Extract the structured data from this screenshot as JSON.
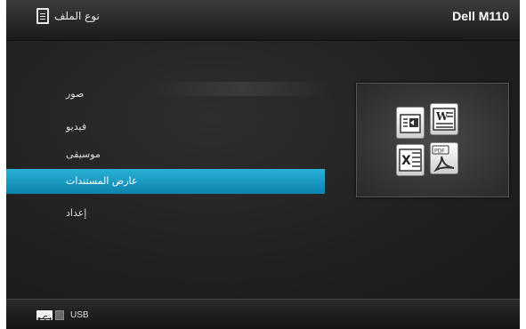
{
  "header": {
    "title": "نوع الملف",
    "icon": "document-icon",
    "brand": "Dell M110"
  },
  "menu": {
    "items": [
      {
        "label": "صور",
        "selected": false
      },
      {
        "label": "فيديو",
        "selected": false
      },
      {
        "label": "موسيقى",
        "selected": false
      },
      {
        "label": "عارض المستندات",
        "selected": true
      },
      {
        "label": "إعداد",
        "selected": false
      }
    ]
  },
  "preview": {
    "icons": [
      "powerpoint-icon",
      "word-icon",
      "excel-icon",
      "pdf-icon"
    ]
  },
  "footer": {
    "source_icon": "usb-icon",
    "source_label": "USB"
  },
  "colors": {
    "accent": "#1a9fc8",
    "background": "#1c1c1c"
  }
}
